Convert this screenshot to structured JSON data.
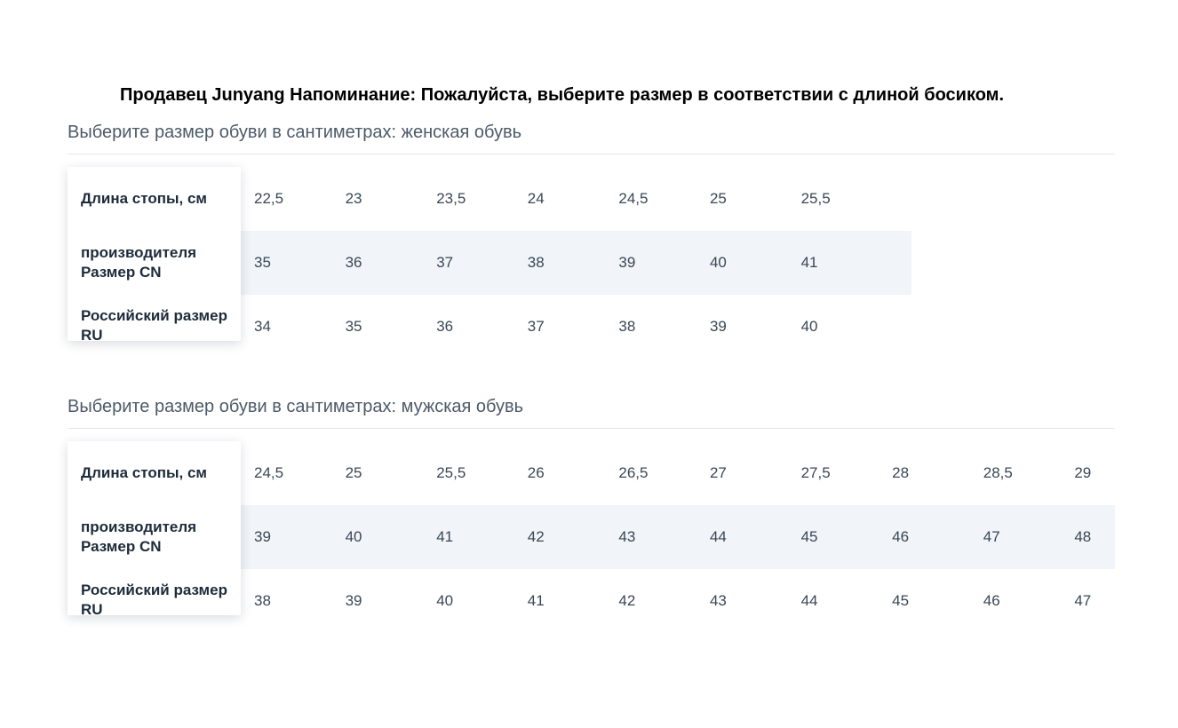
{
  "notice": "Продавец Junyang Напоминание: Пожалуйста, выберите размер в соответствии с длиной босиком.",
  "tables": [
    {
      "title": "Выберите размер обуви в сантиметрах: женская обувь",
      "rows": [
        {
          "label": "Длина стопы, см",
          "values": [
            "22,5",
            "23",
            "23,5",
            "24",
            "24,5",
            "25",
            "25,5"
          ]
        },
        {
          "label": "производителя Размер CN",
          "values": [
            "35",
            "36",
            "37",
            "38",
            "39",
            "40",
            "41"
          ]
        },
        {
          "label": "Российский размер RU",
          "values": [
            "34",
            "35",
            "36",
            "37",
            "38",
            "39",
            "40"
          ]
        }
      ]
    },
    {
      "title": "Выберите размер обуви в сантиметрах: мужская обувь",
      "rows": [
        {
          "label": "Длина стопы, см",
          "values": [
            "24,5",
            "25",
            "25,5",
            "26",
            "26,5",
            "27",
            "27,5",
            "28",
            "28,5",
            "29"
          ]
        },
        {
          "label": "производителя Размер CN",
          "values": [
            "39",
            "40",
            "41",
            "42",
            "43",
            "44",
            "45",
            "46",
            "47",
            "48"
          ]
        },
        {
          "label": "Российский размер RU",
          "values": [
            "38",
            "39",
            "40",
            "41",
            "42",
            "43",
            "44",
            "45",
            "46",
            "47"
          ]
        }
      ]
    }
  ]
}
